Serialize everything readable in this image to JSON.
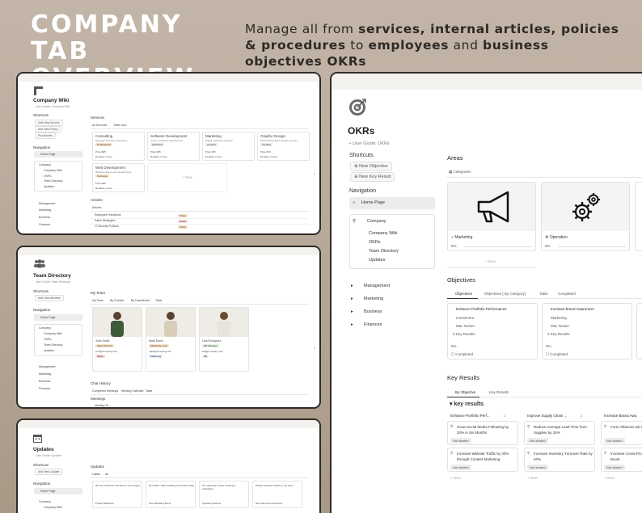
{
  "hero": {
    "title": "COMPANY TAB OVERVIEW",
    "sub_a": "Manage all from ",
    "sub_b": "services, internal articles, policies & procedures",
    "sub_c": " to ",
    "sub_d": "employees",
    "sub_e": " and ",
    "sub_f": "business objectives OKRs"
  },
  "wiki": {
    "title": "Company Wiki",
    "guide": "User Guide: Company Wiki",
    "shortcuts": "Shortcuts",
    "btn1": "Add New Service",
    "btn2": "Add New Policy",
    "btn3": "Procedures",
    "navigation": "Navigation",
    "nav": [
      "Home Page",
      "Company",
      "Company Wiki",
      "OKRs",
      "Team Directory",
      "Updates",
      "Management",
      "Marketing",
      "Business",
      "Finances"
    ],
    "services": "Services",
    "service_tabs": [
      "All Services",
      "Table view"
    ],
    "service_cards": [
      {
        "name": "Consulting",
        "desc": "Strategic business consulting",
        "tag": "Professional",
        "price": "Price $85",
        "dur": "Duration 1 hour"
      },
      {
        "name": "Software Development",
        "desc": "Custom software development",
        "tag": "Technical",
        "price": "Price $95",
        "dur": "Duration 1 hour"
      },
      {
        "name": "Marketing",
        "desc": "Digital marketing strategy",
        "tag": "Creative",
        "price": "Price $75",
        "dur": "Duration 1 hour"
      },
      {
        "name": "Graphic Design",
        "desc": "Brand and graphic design services",
        "tag": "Creative",
        "price": "Price $70",
        "dur": "Duration 1 hour"
      },
      {
        "name": "Web Development",
        "desc": "Website design and development",
        "tag": "Technical",
        "price": "Price $90",
        "dur": "Duration 1 hour"
      }
    ],
    "new_label": "+ New",
    "articles": "Articles",
    "articles_tab": "Articles",
    "article_rows": [
      "Employee Handbook",
      "Sales Strategies",
      "IT Security Policies"
    ],
    "article_tags": [
      "Policy",
      "Guide",
      "Policy"
    ]
  },
  "team": {
    "title": "Team Directory",
    "guide": "User Guide: Team Directory",
    "shortcuts": "Shortcuts",
    "btn1": "Add New Member",
    "navigation": "Navigation",
    "nav": [
      "Home Page",
      "Company",
      "Company Wiki",
      "OKRs",
      "Team Directory",
      "Updates",
      "Management",
      "Marketing",
      "Business",
      "Finances"
    ],
    "my_team": "My Team",
    "tabs": [
      "My Team",
      "By Position",
      "By Department",
      "Table"
    ],
    "members": [
      {
        "name": "John Smith",
        "role": "Sales Director",
        "email": "john@company.com",
        "dept": "Sales"
      },
      {
        "name": "Mark Davis",
        "role": "Marketing Lead",
        "email": "mark@company.com",
        "dept": "Marketing"
      },
      {
        "name": "Lisa Rodriguez",
        "role": "HR Manager",
        "email": "lisa@company.com",
        "dept": "HR"
      }
    ],
    "chat_history": "Chat History",
    "chat_tabs": [
      "Completed Meetings",
      "Meeting Calendar",
      "Table"
    ],
    "meetings": "Meetings",
    "meeting_row": "Meeting Tit"
  },
  "updates": {
    "title": "Updates",
    "guide": "User Guide: Updates",
    "shortcuts": "Shortcuts",
    "btn1": "Add New Update",
    "navigation": "Navigation",
    "nav": [
      "Home Page",
      "Company",
      "Company Wiki"
    ],
    "section": "Updates",
    "tabs": [
      "Latest",
      "All"
    ],
    "cards": [
      "We are excited to introduce a new project",
      "Reminder: Team building event this Friday",
      "Our quarterly review meeting is scheduled",
      "Please welcome Sarah to our team"
    ],
    "card_footers": [
      "Project Milestone",
      "Team Building Event",
      "Quarterly Review",
      "New Hire Announcement"
    ]
  },
  "okr": {
    "title": "OKRs",
    "guide": "User Guide: OKRs",
    "shortcuts": "Shortcuts",
    "btn_new_objective": "New Objective",
    "btn_new_key_result": "New Key Result",
    "navigation": "Navigation",
    "home": "Home Page",
    "company": "Company",
    "sub_nav": [
      "Company Wiki",
      "OKRs",
      "Team Directory",
      "Updates"
    ],
    "groups": [
      "Management",
      "Marketing",
      "Business",
      "Finances"
    ],
    "areas": "Areas",
    "categories": "Categories",
    "area_cards": [
      {
        "name": "Marketing",
        "pct": "0%"
      },
      {
        "name": "Operation",
        "pct": "0%"
      }
    ],
    "new_label": "+ New",
    "objectives": "Objectives",
    "obj_tabs": [
      "Objectives",
      "Objectives ( By Category)",
      "Table",
      "Completed"
    ],
    "objective_cards": [
      {
        "name": "Enhance Portfolio Performance",
        "cat": "Investment",
        "owner": "Mac Notion",
        "kr": "3 Key Results",
        "pct": "0%",
        "done": "Completed"
      },
      {
        "name": "Increase Brand Awareness",
        "cat": "Marketing",
        "owner": "Mac Notion",
        "kr": "2 Key Results",
        "pct": "0%",
        "done": "Completed"
      }
    ],
    "key_results": "Key Results",
    "kr_tabs": [
      "By Objective",
      "Key Results"
    ],
    "kr_heading": "key results",
    "kr_columns": [
      {
        "name": "Enhance Portfolio Perf...",
        "count": "2",
        "items": [
          {
            "text": "Grow Social Media Following by 20% in Six Months",
            "status": "Not started"
          },
          {
            "text": "Increase Website Traffic by 30% through Content Marketing",
            "status": "Not started"
          }
        ]
      },
      {
        "name": "Improve Supply Chain ...",
        "count": "2",
        "items": [
          {
            "text": "Reduce Average Lead Time from Supplier by 15%",
            "status": "Not started"
          },
          {
            "text": "Increase Inventory Turnover Rate by 20%",
            "status": "Not started"
          }
        ]
      },
      {
        "name": "Increase Brand Awa",
        "count": "",
        "items": [
          {
            "text": "Form Alliances wit Complementary B",
            "status": "Not started"
          },
          {
            "text": "Increase Cross-Pro Activities to Boost",
            "status": "Not started"
          }
        ]
      }
    ]
  }
}
